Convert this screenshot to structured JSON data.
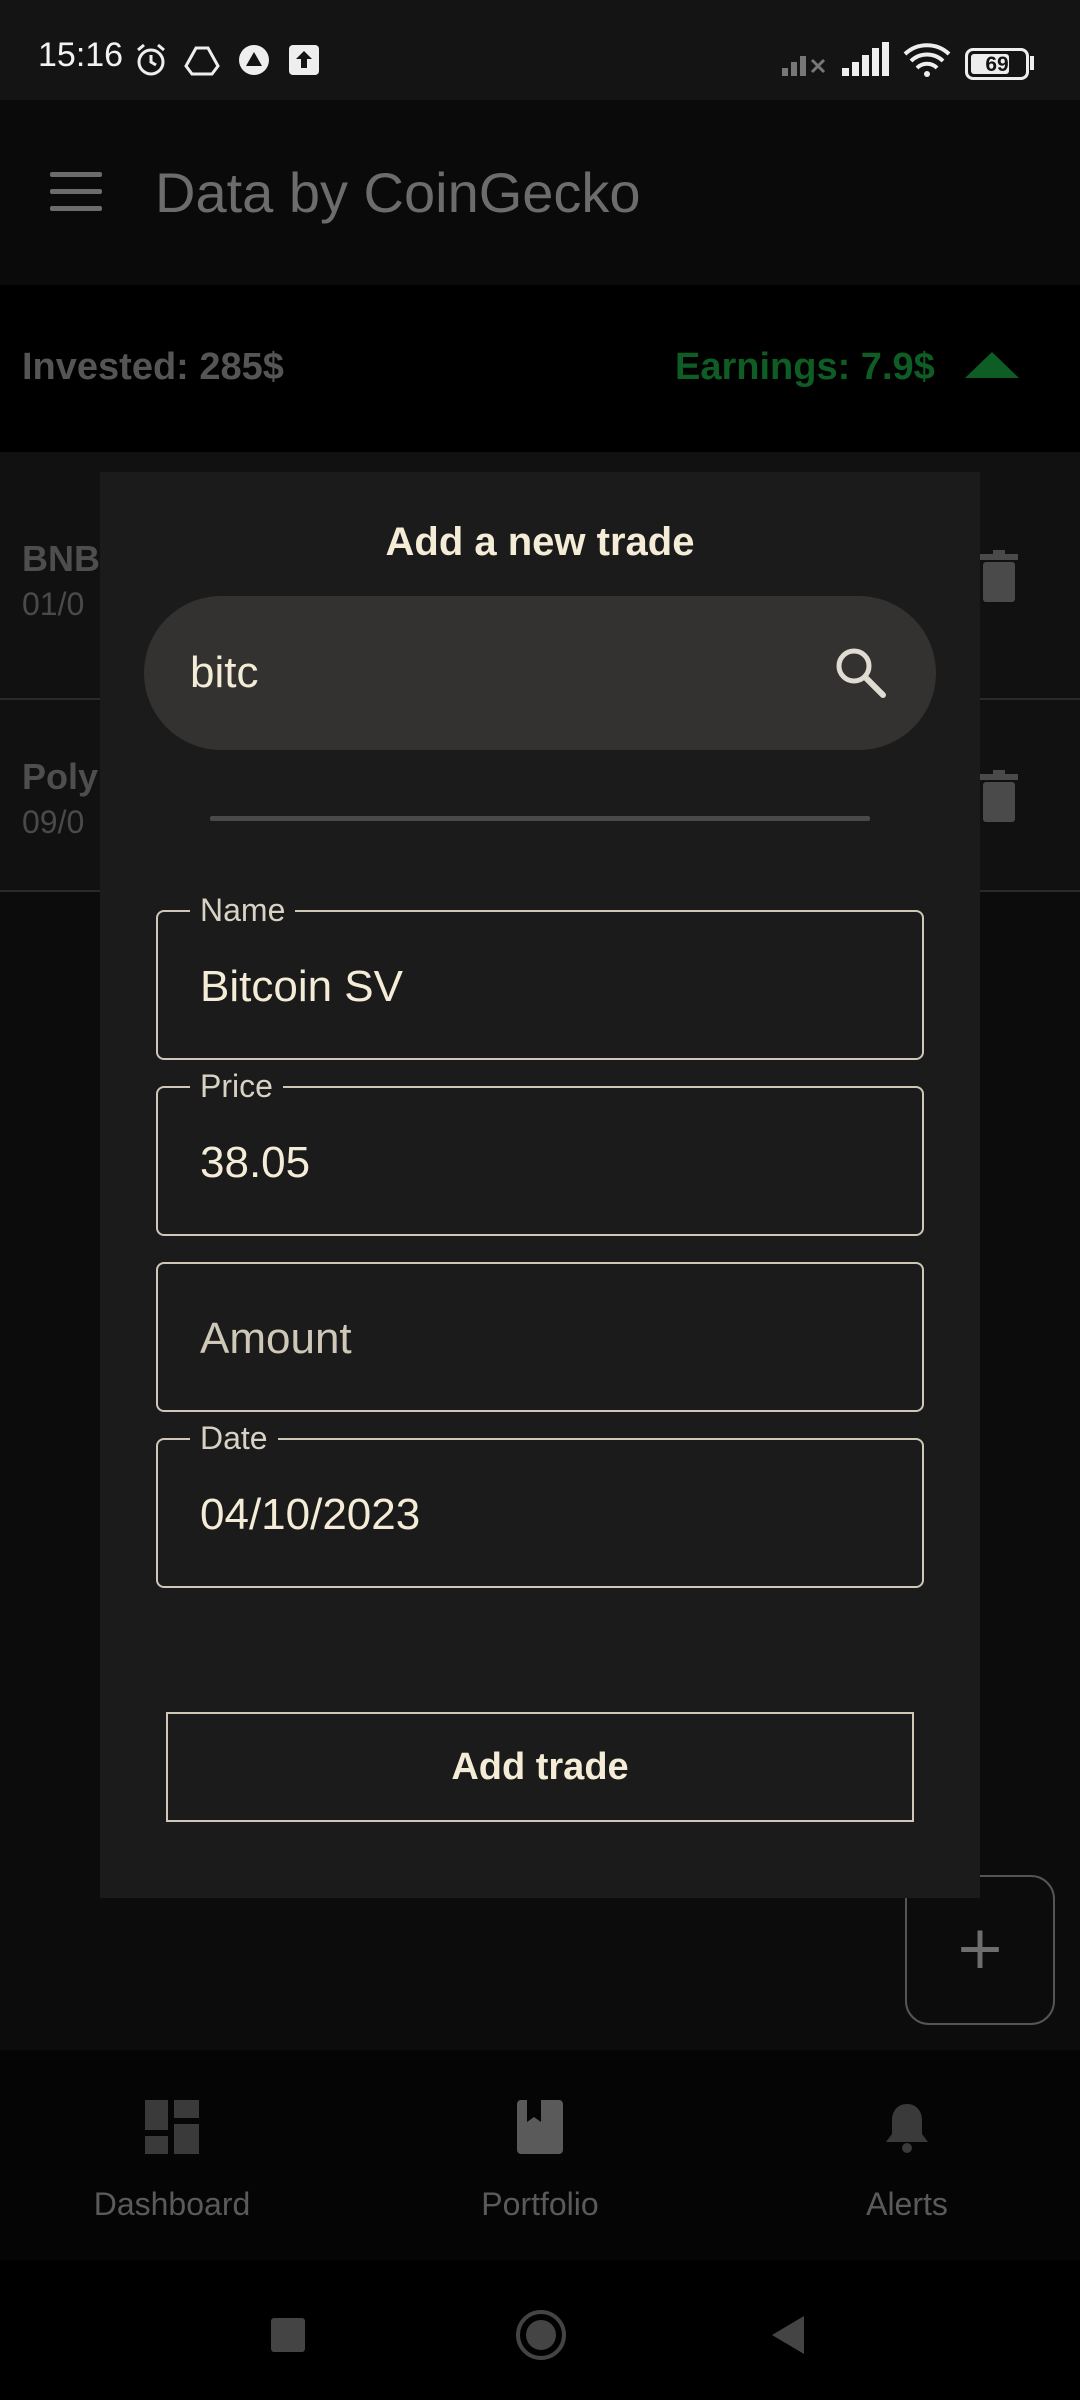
{
  "status_bar": {
    "time": "15:16",
    "battery": "69"
  },
  "app_bar": {
    "title": "Data by CoinGecko"
  },
  "summary": {
    "invested": "Invested: 285$",
    "earnings": "Earnings: 7.9$"
  },
  "background_list": [
    {
      "title": "BNB",
      "subtitle": "01/0"
    },
    {
      "title": "Poly",
      "subtitle": "09/0"
    }
  ],
  "dialog": {
    "title": "Add a new trade",
    "search": {
      "value": "bitc"
    },
    "fields": {
      "name": {
        "label": "Name",
        "value": "Bitcoin SV"
      },
      "price": {
        "label": "Price",
        "value": "38.05"
      },
      "amount": {
        "placeholder": "Amount"
      },
      "date": {
        "label": "Date",
        "value": "04/10/2023"
      }
    },
    "submit_label": "Add trade"
  },
  "fab_label": "+",
  "bottom_nav": [
    {
      "label": "Dashboard",
      "icon": "dashboard-icon"
    },
    {
      "label": "Portfolio",
      "icon": "book-icon"
    },
    {
      "label": "Alerts",
      "icon": "bell-icon"
    }
  ],
  "colors": {
    "earnings": "#0e5d25",
    "dialog_text": "#f4ecd6",
    "dialog_bg": "#1b1b1b"
  }
}
